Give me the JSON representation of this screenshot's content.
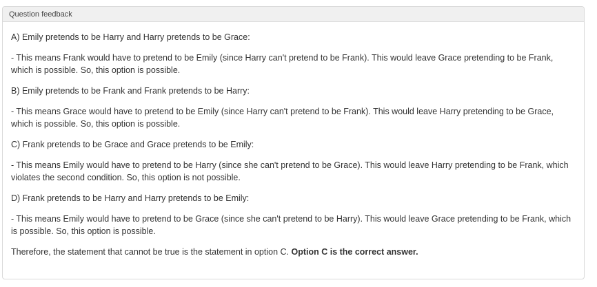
{
  "panel": {
    "title": "Question feedback"
  },
  "feedback": {
    "option_a_heading": "A) Emily pretends to be Harry and Harry pretends to be Grace:",
    "option_a_text": "- This means Frank would have to pretend to be Emily (since Harry can't pretend to be Frank). This would leave Grace pretending to be Frank, which is possible. So, this option is possible.",
    "option_b_heading": "B) Emily pretends to be Frank and Frank pretends to be Harry:",
    "option_b_text": "- This means Grace would have to pretend to be Emily (since Harry can't pretend to be Frank). This would leave Harry pretending to be Grace, which is possible. So, this option is possible.",
    "option_c_heading": "C) Frank pretends to be Grace and Grace pretends to be Emily:",
    "option_c_text": "- This means Emily would have to pretend to be Harry (since she can't pretend to be Grace). This would leave Harry pretending to be Frank, which violates the second condition. So, this option is not possible.",
    "option_d_heading": "D) Frank pretends to be Harry and Harry pretends to be Emily:",
    "option_d_text": "- This means Emily would have to pretend to be Grace (since she can't pretend to be Harry). This would leave Grace pretending to be Frank, which is possible. So, this option is possible.",
    "conclusion_text": "Therefore, the statement that cannot be true is the statement in option C. ",
    "conclusion_bold": "Option C is the correct answer."
  }
}
